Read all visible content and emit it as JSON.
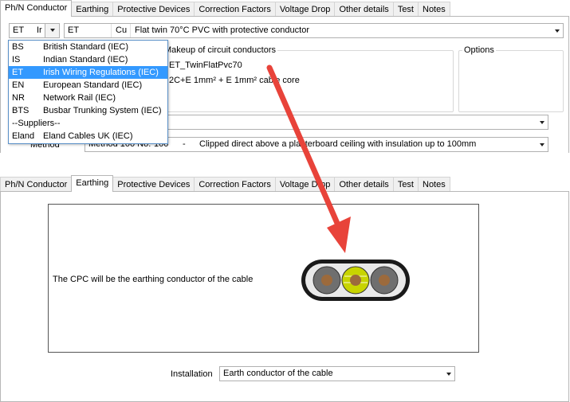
{
  "top_window": {
    "tabs": [
      "Ph/N Conductor",
      "Earthing",
      "Protective Devices",
      "Correction Factors",
      "Voltage Drop",
      "Other details",
      "Test",
      "Notes"
    ],
    "active_tab": "Ph/N Conductor",
    "standard_combo": {
      "code": "ET",
      "text_partial": "Ir"
    },
    "cable_code": "ET",
    "material": "Cu",
    "cable_description": "Flat twin 70°C PVC with protective conductor",
    "makeup_group": {
      "label": "Makeup of circuit conductors",
      "cable_ref": "ET_TwinFlatPvc70",
      "cores": "2C+E 1mm² + E 1mm² cable core"
    },
    "options_group": {
      "label": "Options"
    },
    "method_row": {
      "label": "Method",
      "value_prefix": "Method 100 No.",
      "value_number": "100",
      "value_separator": "-",
      "value_description": "Clipped direct above a plasterboard ceiling with insulation up to 100mm"
    },
    "standards_dropdown": {
      "items": [
        {
          "code": "BS",
          "name": "British Standard (IEC)"
        },
        {
          "code": "IS",
          "name": "Indian Standard (IEC)"
        },
        {
          "code": "ET",
          "name": "Irish Wiring Regulations (IEC)"
        },
        {
          "code": "EN",
          "name": "European Standard (IEC)"
        },
        {
          "code": "NR",
          "name": "Network Rail (IEC)"
        },
        {
          "code": "BTS",
          "name": "Busbar Trunking System (IEC)"
        },
        {
          "code": "",
          "name": "--Suppliers--"
        },
        {
          "code": "Eland",
          "name": "Eland Cables UK (IEC)"
        }
      ],
      "selected_index": 2
    }
  },
  "bottom_window": {
    "tabs": [
      "Ph/N Conductor",
      "Earthing",
      "Protective Devices",
      "Correction Factors",
      "Voltage Drop",
      "Other details",
      "Test",
      "Notes"
    ],
    "active_tab": "Earthing",
    "cpc_text": "The CPC will be the earthing conductor of the cable",
    "installation_label": "Installation",
    "installation_value": "Earth conductor of the cable"
  },
  "colors": {
    "arrow": "#e8433a",
    "selection": "#3399ff",
    "cable_sheath": "#1a1a1a",
    "cable_insulation": "#7a7a7a",
    "copper_core": "#9c6a3c",
    "earth_core": "#c8d400"
  }
}
